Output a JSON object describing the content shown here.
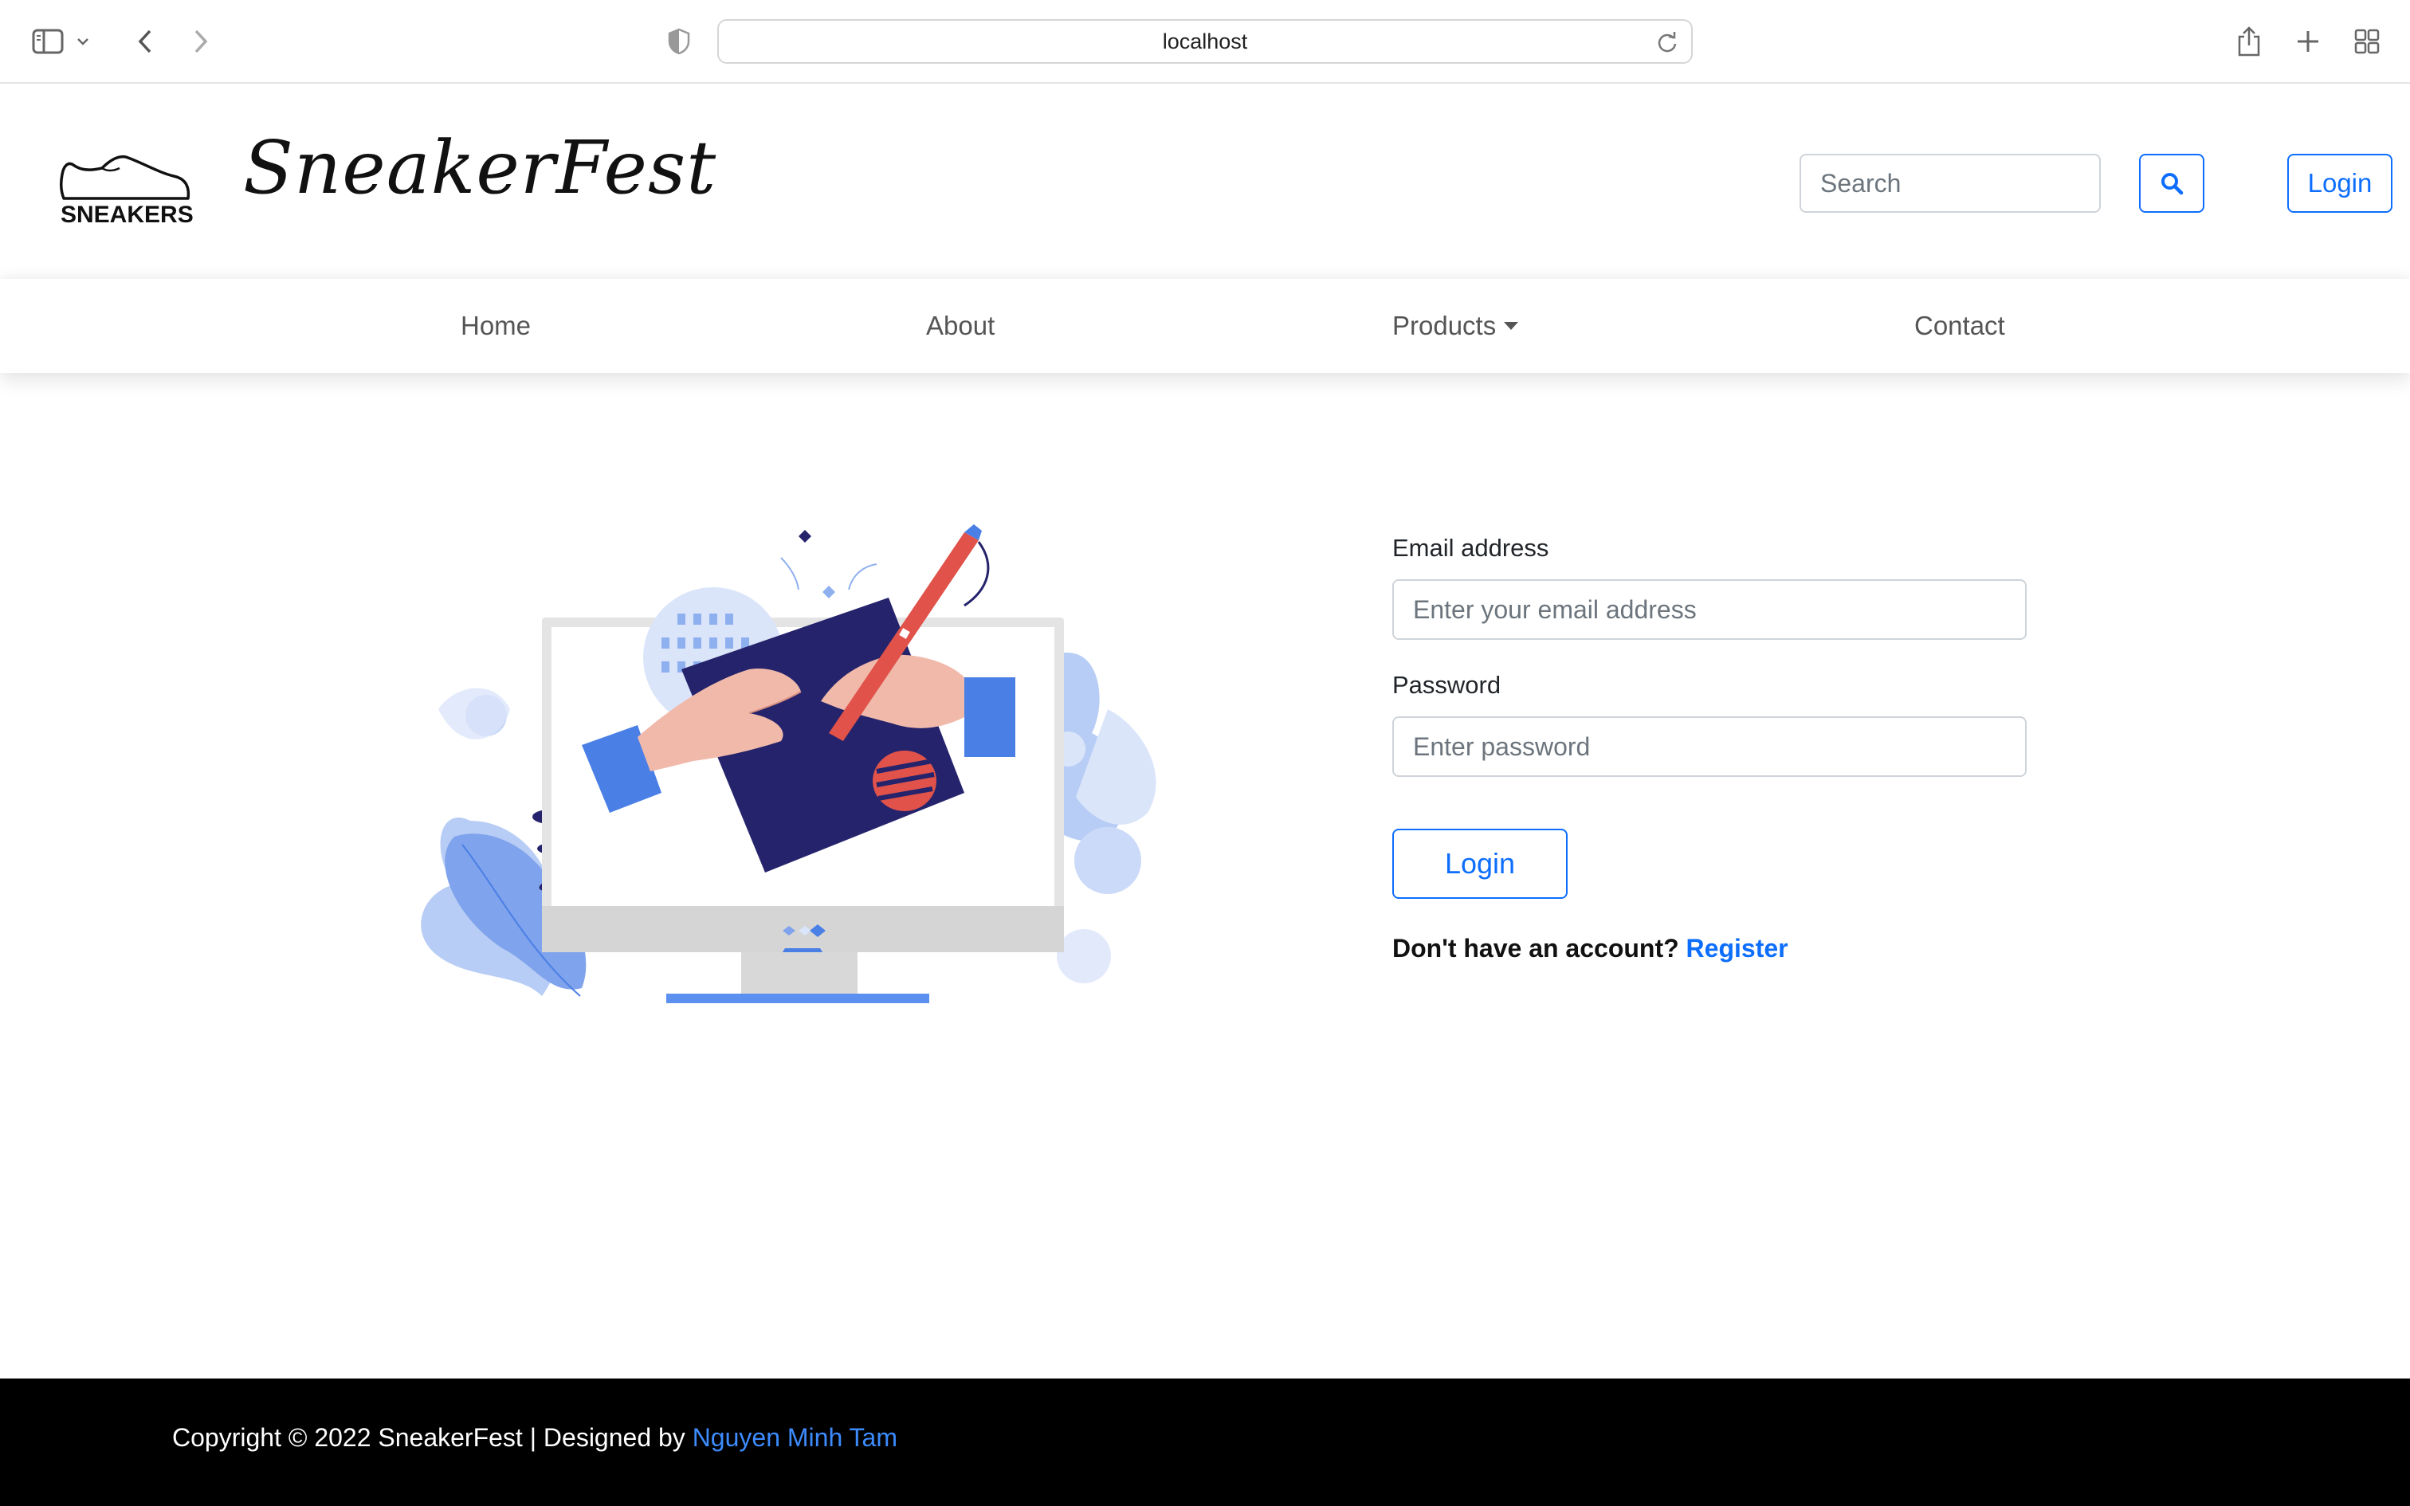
{
  "browser": {
    "url": "localhost"
  },
  "header": {
    "logo_text": "SNEAKERS",
    "brand_name": "SneakerFest",
    "search_placeholder": "Search",
    "login_label": "Login"
  },
  "nav": {
    "items": [
      {
        "label": "Home"
      },
      {
        "label": "About"
      },
      {
        "label": "Products"
      },
      {
        "label": "Contact"
      }
    ]
  },
  "login_form": {
    "email_label": "Email address",
    "email_placeholder": "Enter your email address",
    "password_label": "Password",
    "password_placeholder": "Enter password",
    "submit_label": "Login",
    "register_prompt": "Don't have an account?",
    "register_link": "Register"
  },
  "footer": {
    "copyright": "Copyright © 2022 SneakerFest | Designed by",
    "designer": "Nguyen Minh Tam"
  },
  "colors": {
    "accent": "#0d6efd",
    "footer_bg": "#000000",
    "illustration_navy": "#25236b",
    "illustration_blue": "#4a7fe6",
    "illustration_red": "#e0524a"
  }
}
